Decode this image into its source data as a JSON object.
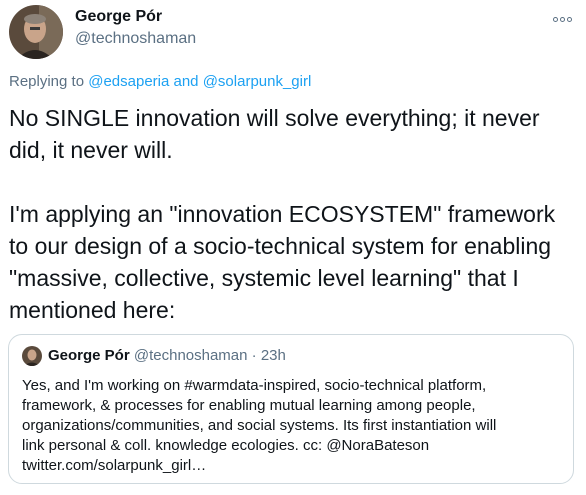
{
  "author": {
    "name": "George Pór",
    "handle": "@technoshaman"
  },
  "more_icon": "more-options-icon",
  "reply": {
    "prefix": "Replying to ",
    "user1": "@edsaperia",
    "connector": " and ",
    "user2": "@solarpunk_girl"
  },
  "tweet": {
    "text": "No SINGLE innovation will solve everything; it never did, it never will.\n\nI'm applying an \"innovation ECOSYSTEM\" framework to our design of a socio-technical system for enabling \"massive, collective, systemic level learning\" that I mentioned here:"
  },
  "quote": {
    "name": "George Pór",
    "handle": "@technoshaman",
    "separator": " · ",
    "time": "23h",
    "lines": [
      "Yes, and I'm working on #warmdata-inspired, socio-technical platform,",
      "framework, & processes for enabling mutual learning among people,",
      "organizations/communities, and social systems. Its first instantiation will",
      "link personal & coll. knowledge ecologies. cc: @NoraBateson",
      "twitter.com/solarpunk_girl…"
    ]
  },
  "colors": {
    "link": "#1da1f2",
    "secondary": "#5b7083",
    "border": "#cfd9de"
  }
}
